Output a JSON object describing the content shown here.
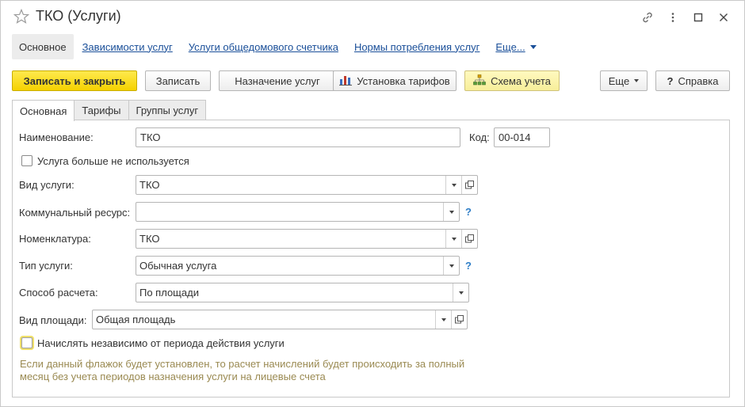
{
  "window": {
    "title": "ТКО (Услуги)",
    "icons": [
      "star-icon",
      "link-icon",
      "more-vertical-icon",
      "maximize-icon",
      "close-icon"
    ]
  },
  "nav": {
    "items": [
      {
        "label": "Основное",
        "active": true
      },
      {
        "label": "Зависимости услуг",
        "active": false
      },
      {
        "label": "Услуги общедомового счетчика",
        "active": false
      },
      {
        "label": "Нормы потребления услуг",
        "active": false
      }
    ],
    "more_label": "Еще..."
  },
  "toolbar": {
    "save_close": "Записать и закрыть",
    "save": "Записать",
    "assign": "Назначение услуг",
    "tariffs": "Установка тарифов",
    "scheme": "Схема учета",
    "more": "Еще",
    "help": "Справка"
  },
  "tabs": [
    {
      "label": "Основная",
      "active": true
    },
    {
      "label": "Тарифы",
      "active": false
    },
    {
      "label": "Группы услуг",
      "active": false
    }
  ],
  "form": {
    "name_label": "Наименование:",
    "name_value": "ТКО",
    "code_label": "Код:",
    "code_value": "00-014",
    "not_used_label": "Услуга больше не используется",
    "service_kind_label": "Вид услуги:",
    "service_kind_value": "ТКО",
    "utility_label": "Коммунальный ресурс:",
    "utility_value": "",
    "nomenclature_label": "Номенклатура:",
    "nomenclature_value": "ТКО",
    "service_type_label": "Тип услуги:",
    "service_type_value": "Обычная услуга",
    "calc_method_label": "Способ расчета:",
    "calc_method_value": "По площади",
    "area_kind_label": "Вид площади:",
    "area_kind_value": "Общая площадь",
    "independent_label": "Начислять независимо от периода действия услуги",
    "note_line1": "Если данный флажок будет установлен, то расчет начислений будет происходить за полный",
    "note_line2": "месяц без учета периодов назначения услуги на лицевые счета",
    "help_mark": "?"
  },
  "colors": {
    "accent_yellow": "#f5d200",
    "link_blue": "#1a4f99",
    "help_blue": "#2f7ec7",
    "note_text": "#9a8a52"
  }
}
